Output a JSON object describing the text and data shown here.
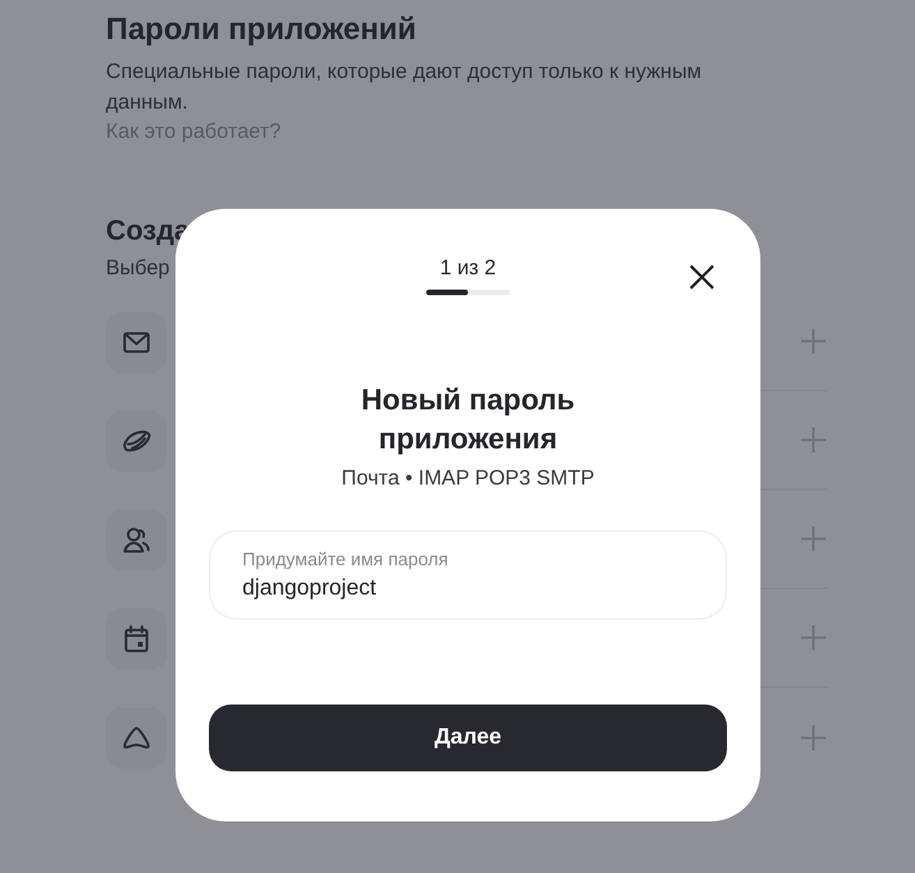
{
  "page": {
    "title": "Пароли приложений",
    "description": "Специальные пароли, которые дают доступ только к нужным данным.",
    "help_link": "Как это работает?",
    "section_title": "Созда",
    "section_hint": "Выбер",
    "app_rows": [
      {
        "kind": "mail"
      },
      {
        "kind": "disk"
      },
      {
        "kind": "contacts"
      },
      {
        "kind": "calendar"
      },
      {
        "kind": "other"
      }
    ]
  },
  "dialog": {
    "step": {
      "label": "1 из 2",
      "level": 0.5
    },
    "title": "Новый пароль приложения",
    "subtitle": "Почта • IMAP POP3 SMTP",
    "field": {
      "label": "Придумайте имя пароля",
      "value": "djangoproject"
    },
    "button": "Далее"
  }
}
